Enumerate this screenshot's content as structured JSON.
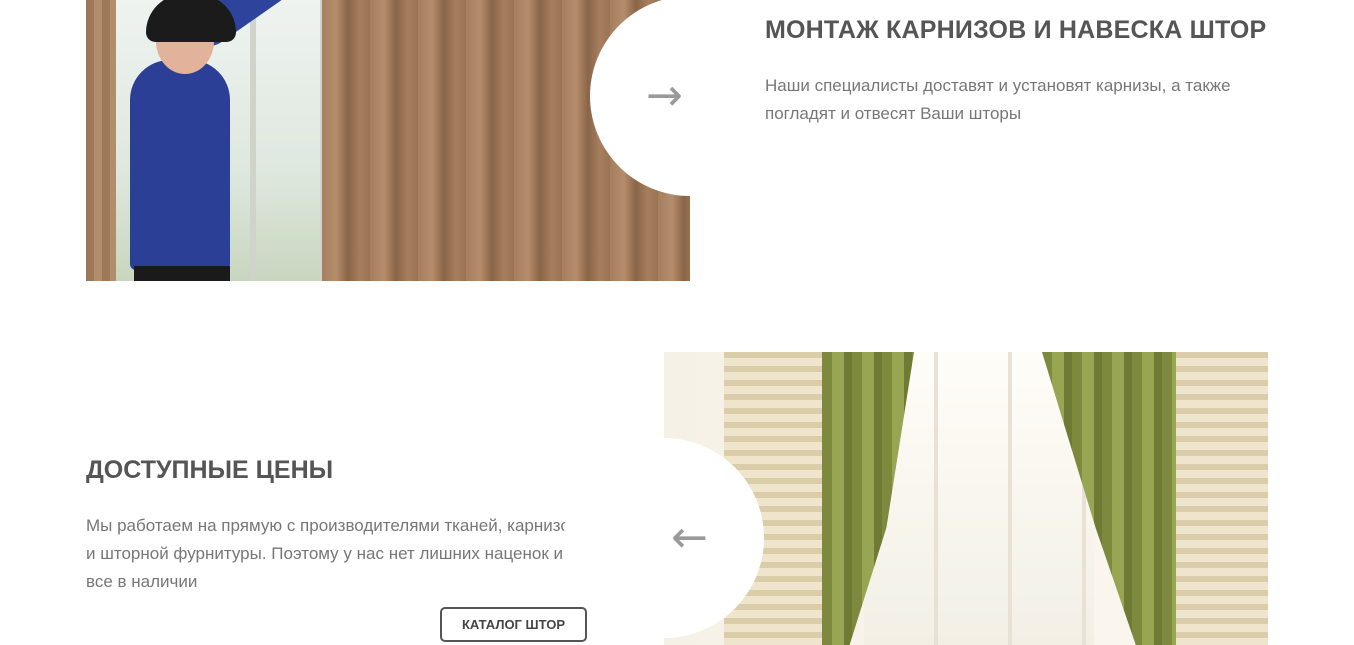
{
  "section1": {
    "title": "МОНТАЖ КАРНИЗОВ И НАВЕСКА ШТОР",
    "description": "Наши специалисты доставят и установят карнизы, а также погладят и отвесят Ваши шторы",
    "arrow": "→",
    "arrow_icon": "arrow-right-icon",
    "image": "installer-hanging-curtains-photo"
  },
  "section2": {
    "title": "ДОСТУПНЫЕ ЦЕНЫ",
    "description": "Мы работаем на прямую с производителями тканей, карнизов и шторной фурнитуры. Поэтому у нас нет лишних наценок и все в наличии",
    "button_label": "КАТАЛОГ ШТОР",
    "arrow": "←",
    "arrow_icon": "arrow-left-icon",
    "image": "green-curtains-window-photo"
  },
  "colors": {
    "heading": "#555555",
    "body_text": "#777777",
    "arrow": "#9a9a9a",
    "button_border": "#555555"
  }
}
